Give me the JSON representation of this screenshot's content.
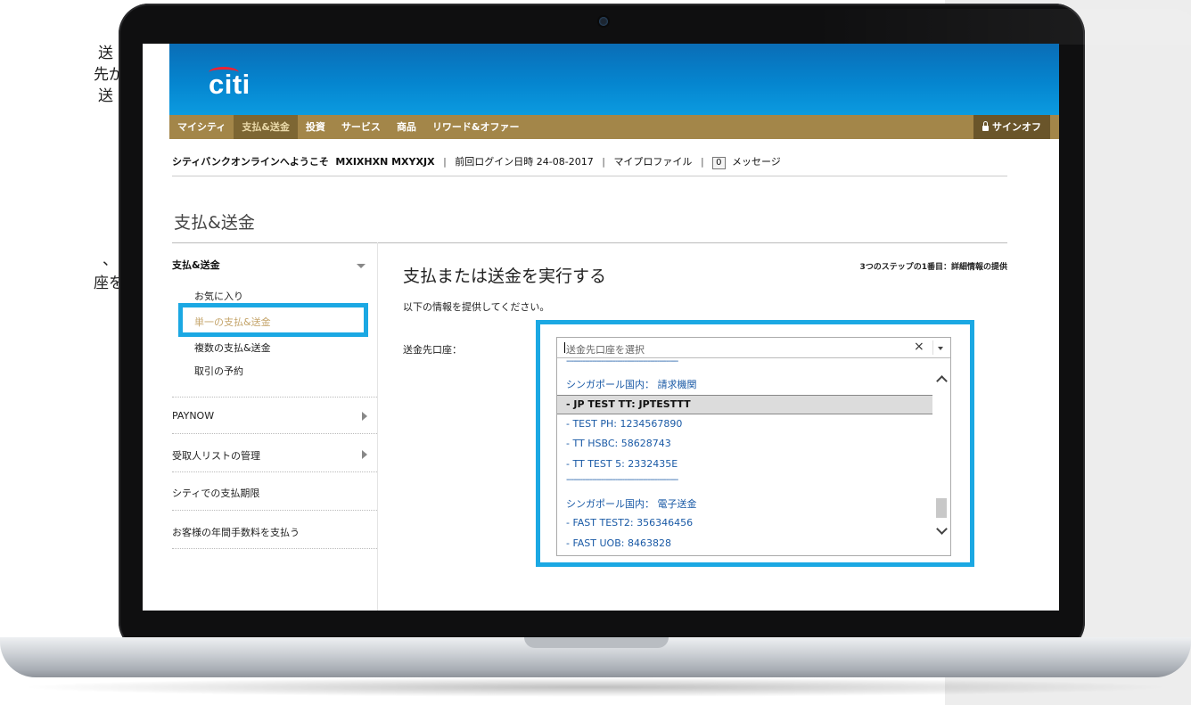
{
  "side_text": {
    "lines": [
      "送",
      "先が",
      "送",
      "、",
      "座を"
    ]
  },
  "header": {
    "logo_text": "citi",
    "nav": [
      "マイシティ",
      "支払&送金",
      "投資",
      "サービス",
      "商品",
      "リワード&オファー"
    ],
    "active_nav": "支払&送金",
    "signoff_label": "サインオフ"
  },
  "welcome": {
    "greeting": "シティバンクオンラインへようこそ",
    "username": "MXIXHXN MXYXJX",
    "last_login": "前回ログイン日時 24-08-2017",
    "profile": "マイプロファイル",
    "message_count": "0",
    "messages": "メッセージ"
  },
  "page_title": "支払&送金",
  "sidebar": {
    "section": "支払&送金",
    "sub_items": [
      "お気に入り",
      "単一の支払&送金",
      "複数の支払&送金",
      "取引の予約"
    ],
    "rows": [
      "PAYNOW",
      "受取人リストの管理",
      "シティでの支払期限",
      "お客様の年間手数料を支払う"
    ]
  },
  "main": {
    "steps_info": "3つのステップの1番目：詳細情報の提供",
    "heading": "支払または送金を実行する",
    "instructions": "以下の情報を提供してください。",
    "field_label": "送金先口座："
  },
  "dropdown": {
    "placeholder": "送金先口座を選択",
    "clear": "×",
    "separator": "------------------------------------------------",
    "group1": "シンガポール国内： 請求機関",
    "group1_options": [
      "- JP TEST TT: JPTESTTT",
      "- TEST PH: 1234567890",
      "- TT HSBC: 58628743",
      "- TT TEST 5: 2332435E"
    ],
    "group2": "シンガポール国内： 電子送金",
    "group2_options": [
      "- FAST TEST2: 356346456",
      "- FAST UOB: 8463828"
    ]
  },
  "colors": {
    "brand_blue": "#0585cf",
    "nav_gold": "#a38649",
    "highlight_cyan": "#1ba8e3"
  }
}
